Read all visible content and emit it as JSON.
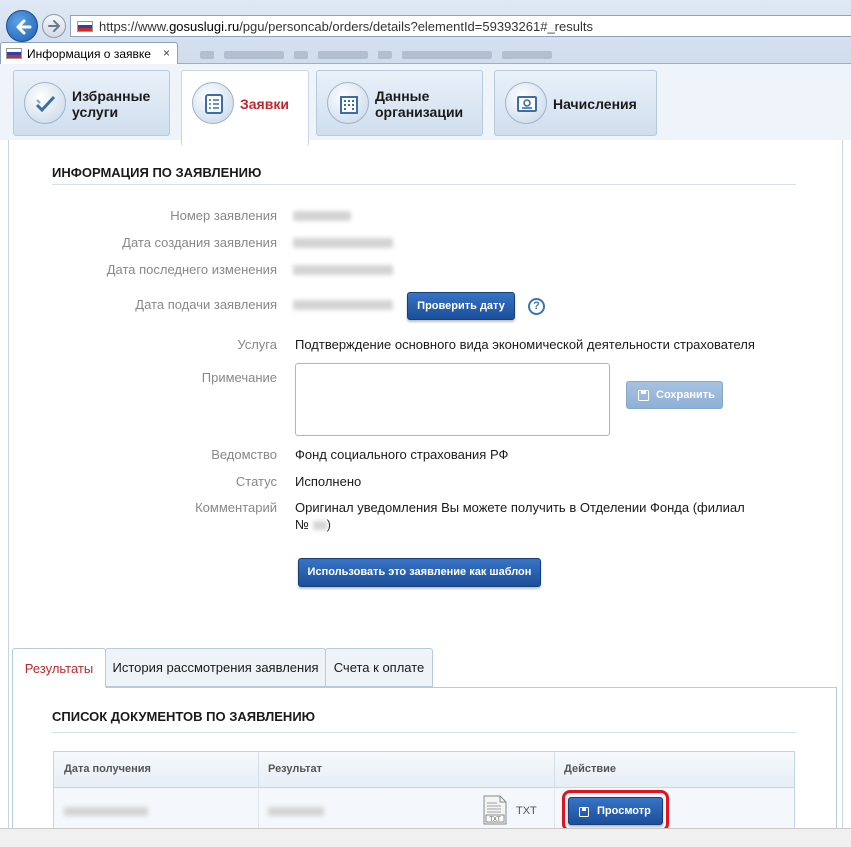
{
  "browser": {
    "url_prefix": "https://www.",
    "url_domain": "gosuslugi.ru",
    "url_path": "/pgu/personcab/orders/details?elementId=59393261#_results",
    "tab_title": "Информация о заявке",
    "tab_close": "×"
  },
  "nav": {
    "items": [
      {
        "label": "Избранные\nуслуги",
        "icon": "check-marks-icon"
      },
      {
        "label": "Заявки",
        "icon": "checklist-icon"
      },
      {
        "label": "Данные\nорганизации",
        "icon": "building-icon"
      },
      {
        "label": "Начисления",
        "icon": "certificate-icon"
      }
    ]
  },
  "info": {
    "title": "ИНФОРМАЦИЯ ПО ЗАЯВЛЕНИЮ",
    "number_label": "Номер заявления",
    "created_label": "Дата создания заявления",
    "modified_label": "Дата последнего изменения",
    "submitted_label": "Дата подачи заявления",
    "check_date_button": "Проверить дату",
    "help_mark": "?",
    "service_label": "Услуга",
    "service_value": "Подтверждение основного вида экономической деятельности страхователя",
    "note_label": "Примечание",
    "note_value": "",
    "save_button": "Сохранить",
    "agency_label": "Ведомство",
    "agency_value": "Фонд социального страхования РФ",
    "status_label": "Статус",
    "status_value": "Исполнено",
    "comment_label": "Комментарий",
    "comment_value_1": "Оригинал уведомления Вы можете получить в Отделении Фонда (филиал",
    "comment_value_2": "№",
    "comment_value_3": ")",
    "template_button": "Использовать это заявление как шаблон"
  },
  "result_tabs": [
    {
      "label": "Результаты",
      "active": true
    },
    {
      "label": "История рассмотрения заявления",
      "active": false
    },
    {
      "label": "Счета к оплате",
      "active": false
    }
  ],
  "documents": {
    "title": "СПИСОК ДОКУМЕНТОВ ПО ЗАЯВЛЕНИЮ",
    "columns": [
      "Дата получения",
      "Результат",
      "Действие"
    ],
    "file_type": "TXT",
    "view_button": "Просмотр"
  },
  "colors": {
    "accent_red": "#c0282d",
    "button_blue": "#1b4f9a",
    "highlight_ring": "#e0141e"
  }
}
